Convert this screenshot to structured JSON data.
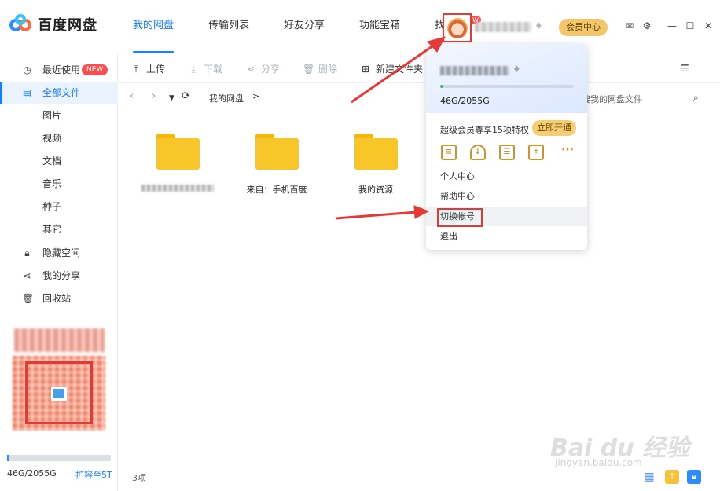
{
  "app": {
    "name": "百度网盘"
  },
  "nav": {
    "tabs": [
      "我的网盘",
      "传输列表",
      "好友分享",
      "功能宝箱",
      "找资源"
    ],
    "badge": "NEW"
  },
  "header": {
    "vip_label": "会员中心"
  },
  "sidebar": {
    "items": [
      {
        "label": "最近使用",
        "icon": "clock-icon"
      },
      {
        "label": "全部文件",
        "icon": "file-icon"
      },
      {
        "label": "图片",
        "icon": ""
      },
      {
        "label": "视频",
        "icon": ""
      },
      {
        "label": "文档",
        "icon": ""
      },
      {
        "label": "音乐",
        "icon": ""
      },
      {
        "label": "种子",
        "icon": ""
      },
      {
        "label": "其它",
        "icon": ""
      },
      {
        "label": "隐藏空间",
        "icon": "lock-icon"
      },
      {
        "label": "我的分享",
        "icon": "share-icon"
      },
      {
        "label": "回收站",
        "icon": "trash-icon"
      }
    ],
    "new_badge": "NEW",
    "storage_text": "46G/2055G",
    "storage_ratio": 0.022,
    "expand_label": "扩容至5T"
  },
  "toolbar": {
    "upload": "上传",
    "download": "下载",
    "share": "分享",
    "delete": "删除",
    "new_folder": "新建文件夹"
  },
  "pathbar": {
    "crumb": "我的网盘",
    "sep": ">",
    "search_placeholder": "搜我的网盘文件"
  },
  "folders": [
    {
      "label": ""
    },
    {
      "label": "来自：手机百度"
    },
    {
      "label": "我的资源"
    }
  ],
  "footer": {
    "count": "3项"
  },
  "dropdown": {
    "storage": "46G/2055G",
    "storage_ratio": 0.022,
    "vip_text": "超级会员尊享15项特权",
    "vip_button": "立即开通",
    "privilege_icons": [
      "speed-icon",
      "download-boost-icon",
      "document-icon",
      "upload-20g-icon",
      "more-icon"
    ],
    "menu": [
      "个人中心",
      "帮助中心",
      "切换帐号",
      "退出"
    ]
  },
  "watermark": {
    "brand": "Bai du 经验",
    "url": "jingyan.baidu.com"
  },
  "colors": {
    "accent": "#1a7cff",
    "annotation": "#e53935",
    "folder": "#f8c628",
    "vip": "#f3c66b"
  }
}
